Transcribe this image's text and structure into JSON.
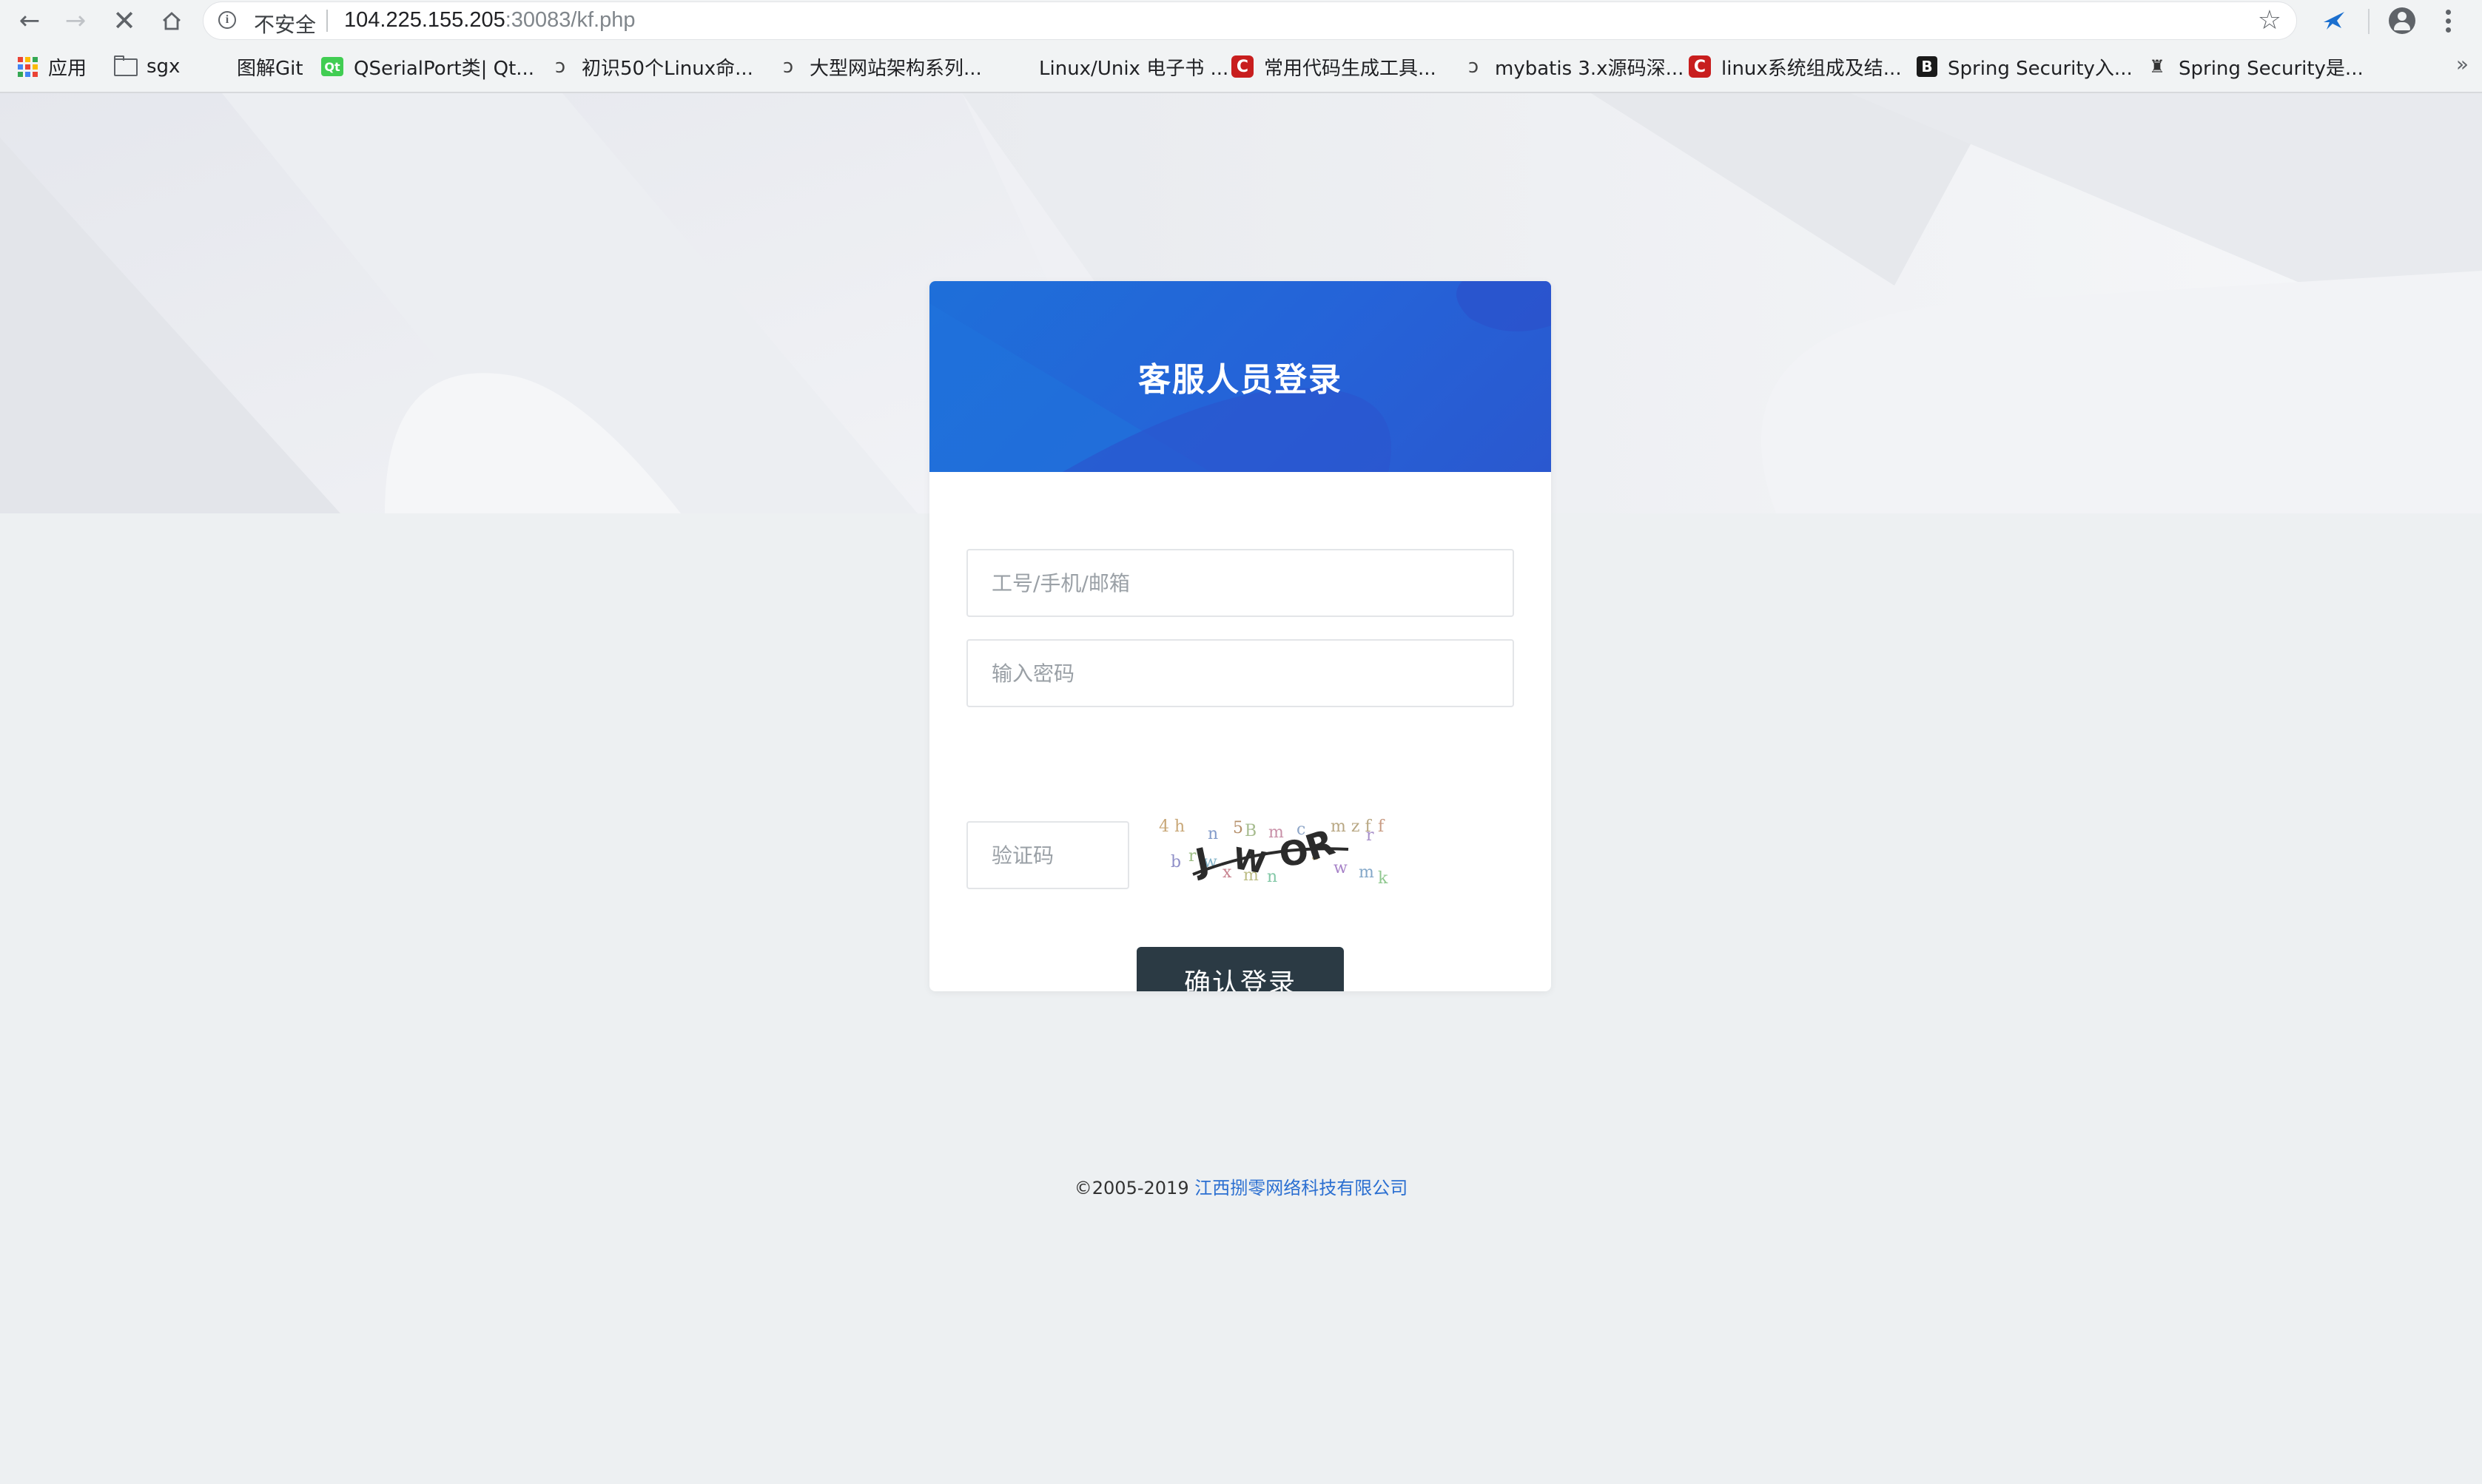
{
  "browser": {
    "security_label": "不安全",
    "url_host": "104.225.155.205",
    "url_rest": ":30083/kf.php",
    "bookmarks": [
      {
        "label": "应用",
        "icon": "apps-grid-icon"
      },
      {
        "label": "sgx",
        "icon": "folder-icon"
      },
      {
        "label": "图解Git",
        "icon": "page-icon"
      },
      {
        "label": "QSerialPort类| Qt...",
        "icon": "qt-icon"
      },
      {
        "label": "初识50个Linux命...",
        "icon": "swirl-icon"
      },
      {
        "label": "大型网站架构系列...",
        "icon": "swirl-icon"
      },
      {
        "label": "Linux/Unix 电子书 ...",
        "icon": "page-icon"
      },
      {
        "label": "常用代码生成工具...",
        "icon": "csdn-icon"
      },
      {
        "label": "mybatis 3.x源码深...",
        "icon": "swirl-icon"
      },
      {
        "label": "linux系统组成及结...",
        "icon": "csdn-icon"
      },
      {
        "label": "Spring Security入...",
        "icon": "b-icon"
      },
      {
        "label": "Spring Security是...",
        "icon": "bs-icon"
      }
    ],
    "bookmarks_more": "»"
  },
  "login": {
    "title": "客服人员登录",
    "account_placeholder": "工号/手机/邮箱",
    "password_placeholder": "输入密码",
    "captcha_placeholder": "验证码",
    "submit_label": "确认登录"
  },
  "captcha_text": "JWOR",
  "footer": {
    "copyright": "©2005-2019 ",
    "company": "江西捌零网络科技有限公司"
  },
  "colors": {
    "header_blue": "#1e6fd9",
    "button_dark": "#2b3a44",
    "link_blue": "#2b6fd1",
    "page_bg": "#edf0f2"
  }
}
